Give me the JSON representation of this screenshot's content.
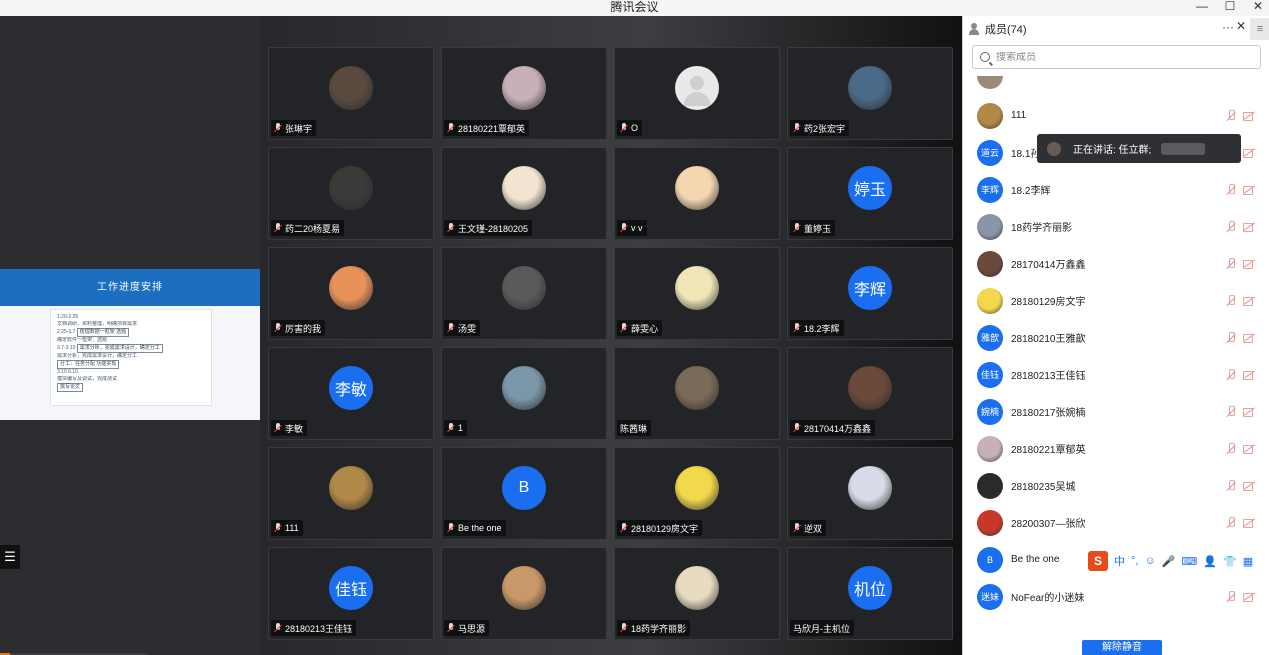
{
  "window": {
    "title": "腾讯会议",
    "controls": [
      "—",
      "☐",
      "✕"
    ]
  },
  "shared_screen": {
    "slide_title": "工作进度安排",
    "slide_lines": [
      "1.20-2.25",
      "文档调研、资料整理，明确项目需求",
      "2.25-3.7",
      "确定软件一框架：选题",
      "3.7-3.10",
      "需求分析，完成需求设计，确定分工",
      "3.10 6.10",
      "模块编写及调试，完成测试"
    ],
    "slide_boxes": [
      "梳理数据一框架 选题",
      "需求分析，完成需求设计，确定分工",
      "分工：任务分配 功能实现",
      "撰写论文"
    ],
    "list_toggle": "☰"
  },
  "tiles": [
    {
      "name": "张琳宇",
      "avatar_type": "photo",
      "color": "#5a4a3e"
    },
    {
      "name": "28180221覃郁英",
      "avatar_type": "photo",
      "color": "#c8b0b8"
    },
    {
      "name": "O",
      "avatar_type": "placeholder",
      "color": "#e9e9e9"
    },
    {
      "name": "药2张宏宇",
      "avatar_type": "photo",
      "color": "#4a6a88"
    },
    {
      "name": "药二20杨夏易",
      "avatar_type": "photo",
      "color": "#3c3a38"
    },
    {
      "name": "王文瑾-28180205",
      "avatar_type": "photo",
      "color": "#f2e4d0"
    },
    {
      "name": "v v",
      "avatar_type": "photo",
      "color": "#f4d7b0"
    },
    {
      "name": "董婷玉",
      "avatar_type": "text",
      "avatar_text": "婷玉"
    },
    {
      "name": "厉害的我",
      "avatar_type": "photo",
      "color": "#e8925a"
    },
    {
      "name": "汤雯",
      "avatar_type": "photo",
      "color": "#5a5a5a"
    },
    {
      "name": "薛雯心",
      "avatar_type": "photo",
      "color": "#f0e6b8"
    },
    {
      "name": "18.2李辉",
      "avatar_type": "text",
      "avatar_text": "李辉"
    },
    {
      "name": "李敏",
      "avatar_type": "text",
      "avatar_text": "李敏"
    },
    {
      "name": "1",
      "avatar_type": "photo",
      "color": "#7a96a8"
    },
    {
      "name": "陈茜琳",
      "avatar_type": "photo",
      "color": "#7a6a58",
      "muted_icon": false
    },
    {
      "name": "28170414万鑫鑫",
      "avatar_type": "photo",
      "color": "#6a4a3a"
    },
    {
      "name": "111",
      "avatar_type": "photo",
      "color": "#b08848"
    },
    {
      "name": "Be the one",
      "avatar_type": "text",
      "avatar_text": "B"
    },
    {
      "name": "28180129房文宇",
      "avatar_type": "photo",
      "color": "#f2d84a"
    },
    {
      "name": "逆双",
      "avatar_type": "photo",
      "color": "#d8dce8"
    },
    {
      "name": "28180213王佳钰",
      "avatar_type": "text",
      "avatar_text": "佳钰"
    },
    {
      "name": "马思源",
      "avatar_type": "photo",
      "color": "#c89868"
    },
    {
      "name": "18药学齐丽影",
      "avatar_type": "photo",
      "color": "#e8dcc0"
    },
    {
      "name": "马欣月-主机位",
      "avatar_type": "text",
      "avatar_text": "机位",
      "muted_icon": false
    }
  ],
  "members_panel": {
    "title": "成员(74)",
    "more_label": "···",
    "close_label": "✕",
    "side_label": "≡",
    "search_placeholder": "搜索成员",
    "members": [
      {
        "name": "111",
        "avatar_type": "photo",
        "color": "#b08848"
      },
      {
        "name": "18.1孙",
        "avatar_type": "text",
        "avatar_text": "道云"
      },
      {
        "name": "18.2李辉",
        "avatar_type": "text",
        "avatar_text": "李辉"
      },
      {
        "name": "18药学齐丽影",
        "avatar_type": "photo",
        "color": "#8a96a8"
      },
      {
        "name": "28170414万鑫鑫",
        "avatar_type": "photo",
        "color": "#6a4a3a"
      },
      {
        "name": "28180129房文宇",
        "avatar_type": "photo",
        "color": "#f2d84a"
      },
      {
        "name": "28180210王雅歆",
        "avatar_type": "text",
        "avatar_text": "雅歆"
      },
      {
        "name": "28180213王佳钰",
        "avatar_type": "text",
        "avatar_text": "佳钰"
      },
      {
        "name": "28180217张婉楠",
        "avatar_type": "text",
        "avatar_text": "婉楠"
      },
      {
        "name": "28180221覃郁英",
        "avatar_type": "photo",
        "color": "#c8b0b8"
      },
      {
        "name": "28180235吴城",
        "avatar_type": "photo",
        "color": "#2a2a2a"
      },
      {
        "name": "28200307—张欣",
        "avatar_type": "photo",
        "color": "#c8382a"
      },
      {
        "name": "Be the one",
        "avatar_type": "text",
        "avatar_text": "B"
      },
      {
        "name": "NoFear的小迷妹",
        "avatar_type": "text",
        "avatar_text": "迷妹"
      }
    ],
    "speaking_label": "正在讲话: 任立群;",
    "unmute_label": "解除静音"
  },
  "ime_toolbar": {
    "logo": "S",
    "items": [
      "中",
      "°,",
      "☺",
      "🎤",
      "⌨",
      "👤",
      "👕",
      "▦"
    ]
  },
  "colors": {
    "accent": "#1a6ff0",
    "muted_red": "#e33b3b",
    "panel_bg": "#ffffff",
    "grid_bg": "#232427"
  }
}
